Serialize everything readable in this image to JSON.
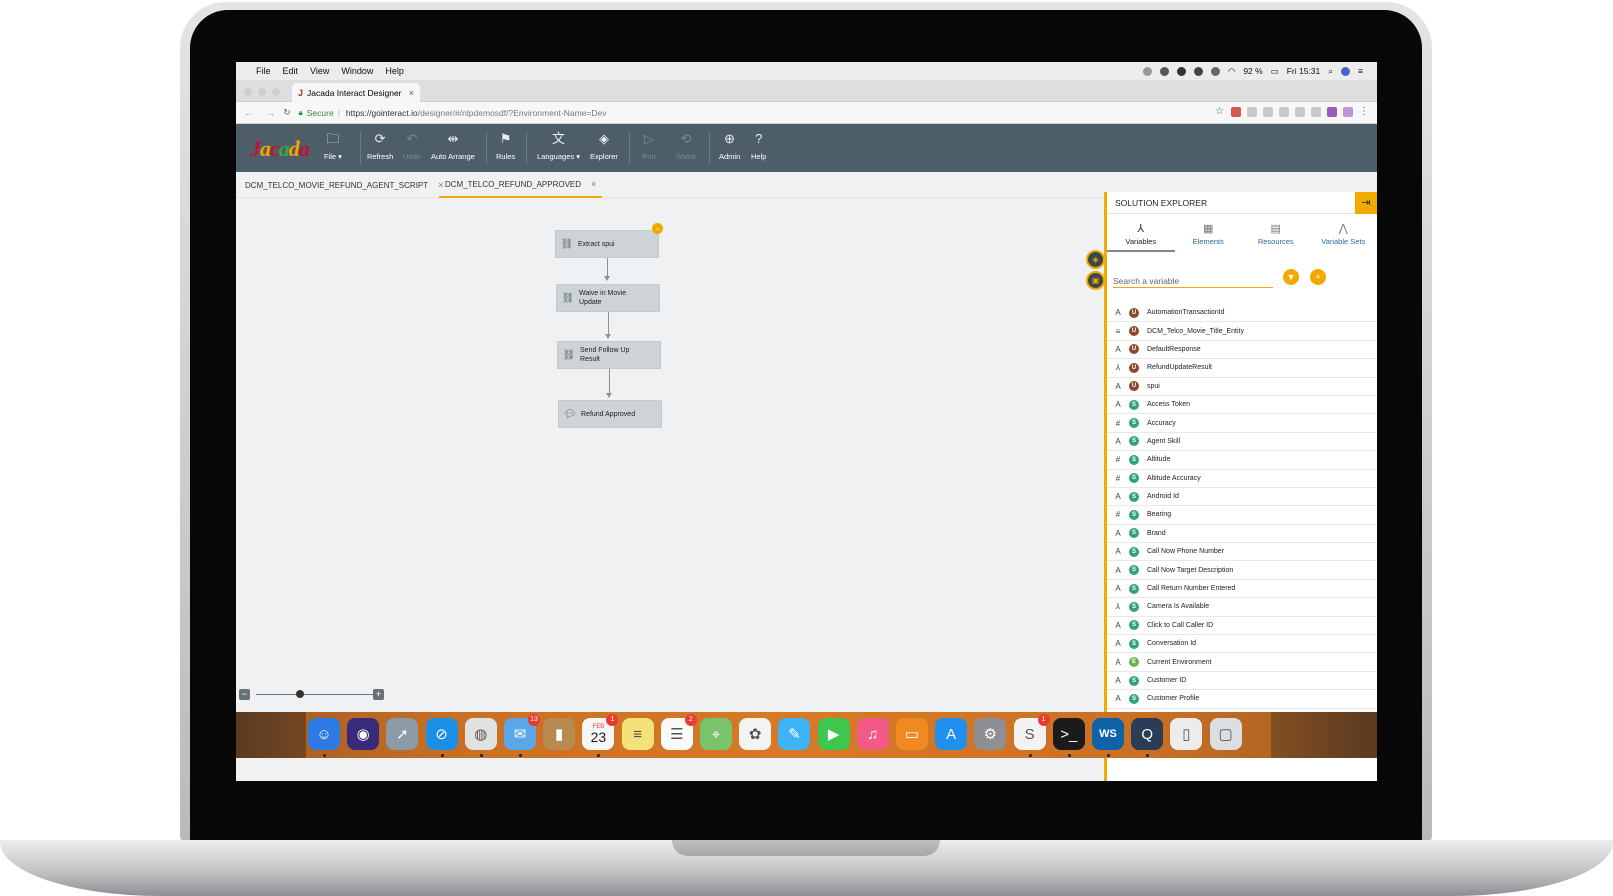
{
  "os_menu": {
    "items": [
      "File",
      "Edit",
      "View",
      "Window",
      "Help"
    ],
    "battery": "92 %",
    "clock": "Fri 15:31"
  },
  "browser": {
    "tab_title": "Jacada Interact Designer",
    "secure_label": "Secure",
    "url_host": "https://gointeract.io",
    "url_path": "/designer/#/nlpdemosdf/?Environment-Name=Dev"
  },
  "toolbar": {
    "logo": "Jacada",
    "buttons": [
      {
        "label": "File ▾",
        "icon": "folder-icon",
        "enabled": true
      },
      {
        "label": "Refresh",
        "icon": "refresh-icon",
        "enabled": true
      },
      {
        "label": "Undo",
        "icon": "undo-icon",
        "enabled": false
      },
      {
        "label": "Auto Arrange",
        "icon": "arrange-icon",
        "enabled": true
      },
      {
        "label": "Rules",
        "icon": "signpost-icon",
        "enabled": true
      },
      {
        "label": "Languages ▾",
        "icon": "translate-icon",
        "enabled": true
      },
      {
        "label": "Explorer",
        "icon": "compass-icon",
        "enabled": true
      },
      {
        "label": "Run",
        "icon": "play-icon",
        "enabled": false
      },
      {
        "label": "Share",
        "icon": "share-icon",
        "enabled": false
      },
      {
        "label": "Admin",
        "icon": "globe-icon",
        "enabled": true
      },
      {
        "label": "Help",
        "icon": "help-icon",
        "enabled": true
      }
    ]
  },
  "doc_tabs": [
    {
      "label": "DCM_TELCO_MOVIE_REFUND_AGENT_SCRIPT",
      "active": false
    },
    {
      "label": "DCM_TELCO_REFUND_APPROVED",
      "active": true
    }
  ],
  "flow": {
    "nodes": [
      {
        "label": "Extract spui",
        "icon": "link-icon"
      },
      {
        "label": "Waive in Movie Update",
        "icon": "link-icon"
      },
      {
        "label": "Send Follow Up Result",
        "icon": "link-icon"
      },
      {
        "label": "Refund Approved",
        "icon": "speech-bubble-icon"
      }
    ]
  },
  "explorer": {
    "title": "SOLUTION EXPLORER",
    "tabs": [
      {
        "label": "Variables",
        "icon": "variables-icon",
        "active": true
      },
      {
        "label": "Elements",
        "icon": "elements-icon",
        "active": false
      },
      {
        "label": "Resources",
        "icon": "resources-icon",
        "active": false
      },
      {
        "label": "Variable Sets",
        "icon": "variable-sets-icon",
        "active": false
      }
    ],
    "search_placeholder": "Search a variable",
    "variables": [
      {
        "name": "AutomationTransactionId",
        "type": "A",
        "scope": "U"
      },
      {
        "name": "DCM_Telco_Movie_Title_Entity",
        "type": "≡",
        "scope": "U"
      },
      {
        "name": "DefaultResponse",
        "type": "A",
        "scope": "U"
      },
      {
        "name": "RefundUpdateResult",
        "type": "⅄",
        "scope": "U"
      },
      {
        "name": "spui",
        "type": "A",
        "scope": "U"
      },
      {
        "name": "Access Token",
        "type": "A",
        "scope": "S"
      },
      {
        "name": "Accuracy",
        "type": "#",
        "scope": "S"
      },
      {
        "name": "Agent Skill",
        "type": "A",
        "scope": "S"
      },
      {
        "name": "Altitude",
        "type": "#",
        "scope": "S"
      },
      {
        "name": "Altitude Accuracy",
        "type": "#",
        "scope": "S"
      },
      {
        "name": "Android Id",
        "type": "A",
        "scope": "S"
      },
      {
        "name": "Bearing",
        "type": "#",
        "scope": "S"
      },
      {
        "name": "Brand",
        "type": "A",
        "scope": "S"
      },
      {
        "name": "Call Now Phone Number",
        "type": "A",
        "scope": "S"
      },
      {
        "name": "Call Now Target Description",
        "type": "A",
        "scope": "S"
      },
      {
        "name": "Call Return Number Entered",
        "type": "A",
        "scope": "S"
      },
      {
        "name": "Camera Is Available",
        "type": "⅄",
        "scope": "S"
      },
      {
        "name": "Click to Call Caller ID",
        "type": "A",
        "scope": "S"
      },
      {
        "name": "Conversation Id",
        "type": "A",
        "scope": "S"
      },
      {
        "name": "Current Environment",
        "type": "A",
        "scope": "E"
      },
      {
        "name": "Customer ID",
        "type": "A",
        "scope": "S"
      },
      {
        "name": "Customer Profile",
        "type": "A",
        "scope": "S"
      }
    ]
  },
  "colors": {
    "accent": "#f2a900",
    "toolbar": "#4e5e69",
    "scope_u": "#8b4a2b",
    "scope_s": "#2fa37a",
    "scope_e": "#6cb24a"
  },
  "dock": {
    "apps": [
      {
        "name": "finder-icon",
        "color": "#2c7be5",
        "badge": "",
        "dot": true
      },
      {
        "name": "siri-icon",
        "color": "#3a2a7a",
        "badge": "",
        "dot": false
      },
      {
        "name": "launchpad-icon",
        "color": "#8c9aa6",
        "badge": "",
        "dot": false
      },
      {
        "name": "safari-icon",
        "color": "#1a8fe3",
        "badge": "",
        "dot": true
      },
      {
        "name": "chrome-icon",
        "color": "#e1e1e1",
        "badge": "",
        "dot": true
      },
      {
        "name": "mail-icon",
        "color": "#5aa6e6",
        "badge": "13",
        "dot": true
      },
      {
        "name": "contacts-icon",
        "color": "#b88a4f",
        "badge": "",
        "dot": false
      },
      {
        "name": "calendar-icon",
        "color": "#f7f7f7",
        "badge": "1",
        "dot": true
      },
      {
        "name": "notes-icon",
        "color": "#f5e17a",
        "badge": "",
        "dot": false
      },
      {
        "name": "reminders-icon",
        "color": "#fafafa",
        "badge": "2",
        "dot": false
      },
      {
        "name": "maps-icon",
        "color": "#78c36c",
        "badge": "",
        "dot": false
      },
      {
        "name": "photos-icon",
        "color": "#f3f3f3",
        "badge": "",
        "dot": false
      },
      {
        "name": "messages-icon",
        "color": "#3eb3f5",
        "badge": "",
        "dot": false
      },
      {
        "name": "facetime-icon",
        "color": "#3fc64f",
        "badge": "",
        "dot": false
      },
      {
        "name": "itunes-icon",
        "color": "#f35a87",
        "badge": "",
        "dot": false
      },
      {
        "name": "ibooks-icon",
        "color": "#f08a20",
        "badge": "",
        "dot": false
      },
      {
        "name": "app-store-icon",
        "color": "#1f8ff0",
        "badge": "",
        "dot": false
      },
      {
        "name": "system-preferences-icon",
        "color": "#8d8f93",
        "badge": "",
        "dot": false
      },
      {
        "name": "slack-icon",
        "color": "#f2f2f2",
        "badge": "1",
        "dot": true
      },
      {
        "name": "terminal-icon",
        "color": "#1b1b1b",
        "badge": "",
        "dot": true
      },
      {
        "name": "webstorm-icon",
        "color": "#0d62a8",
        "badge": "",
        "dot": true
      },
      {
        "name": "quicktime-icon",
        "color": "#2a3c56",
        "badge": "",
        "dot": true
      },
      {
        "name": "document-icon",
        "color": "#ececec",
        "badge": "",
        "dot": false
      },
      {
        "name": "trash-icon",
        "color": "#dcdfe2",
        "badge": "",
        "dot": false
      }
    ],
    "calendar_month": "FEB",
    "calendar_day": "23",
    "webstorm_label": "WS"
  }
}
